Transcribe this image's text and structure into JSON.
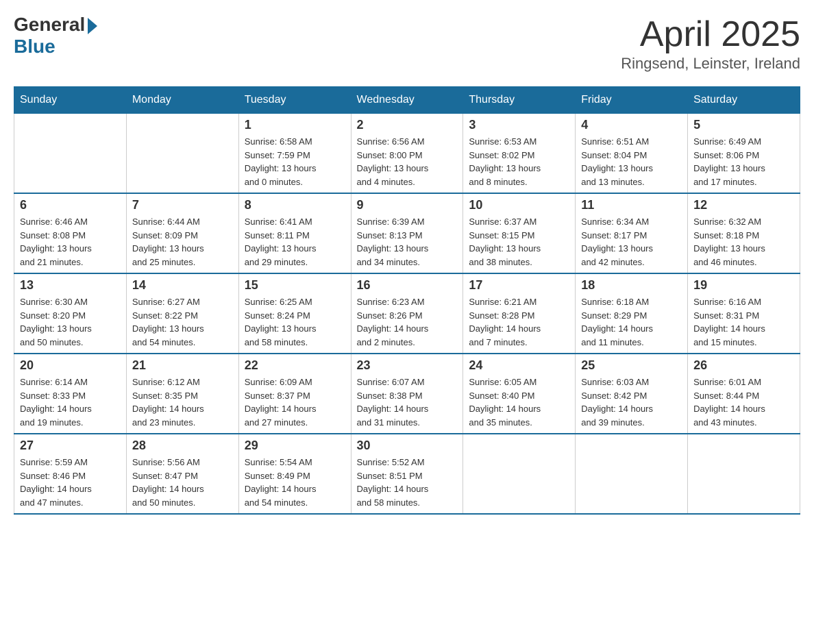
{
  "logo": {
    "general": "General",
    "blue": "Blue"
  },
  "title": "April 2025",
  "location": "Ringsend, Leinster, Ireland",
  "weekdays": [
    "Sunday",
    "Monday",
    "Tuesday",
    "Wednesday",
    "Thursday",
    "Friday",
    "Saturday"
  ],
  "weeks": [
    [
      {
        "day": "",
        "sunrise": "",
        "sunset": "",
        "daylight": ""
      },
      {
        "day": "",
        "sunrise": "",
        "sunset": "",
        "daylight": ""
      },
      {
        "day": "1",
        "sunrise": "Sunrise: 6:58 AM",
        "sunset": "Sunset: 7:59 PM",
        "daylight": "Daylight: 13 hours and 0 minutes."
      },
      {
        "day": "2",
        "sunrise": "Sunrise: 6:56 AM",
        "sunset": "Sunset: 8:00 PM",
        "daylight": "Daylight: 13 hours and 4 minutes."
      },
      {
        "day": "3",
        "sunrise": "Sunrise: 6:53 AM",
        "sunset": "Sunset: 8:02 PM",
        "daylight": "Daylight: 13 hours and 8 minutes."
      },
      {
        "day": "4",
        "sunrise": "Sunrise: 6:51 AM",
        "sunset": "Sunset: 8:04 PM",
        "daylight": "Daylight: 13 hours and 13 minutes."
      },
      {
        "day": "5",
        "sunrise": "Sunrise: 6:49 AM",
        "sunset": "Sunset: 8:06 PM",
        "daylight": "Daylight: 13 hours and 17 minutes."
      }
    ],
    [
      {
        "day": "6",
        "sunrise": "Sunrise: 6:46 AM",
        "sunset": "Sunset: 8:08 PM",
        "daylight": "Daylight: 13 hours and 21 minutes."
      },
      {
        "day": "7",
        "sunrise": "Sunrise: 6:44 AM",
        "sunset": "Sunset: 8:09 PM",
        "daylight": "Daylight: 13 hours and 25 minutes."
      },
      {
        "day": "8",
        "sunrise": "Sunrise: 6:41 AM",
        "sunset": "Sunset: 8:11 PM",
        "daylight": "Daylight: 13 hours and 29 minutes."
      },
      {
        "day": "9",
        "sunrise": "Sunrise: 6:39 AM",
        "sunset": "Sunset: 8:13 PM",
        "daylight": "Daylight: 13 hours and 34 minutes."
      },
      {
        "day": "10",
        "sunrise": "Sunrise: 6:37 AM",
        "sunset": "Sunset: 8:15 PM",
        "daylight": "Daylight: 13 hours and 38 minutes."
      },
      {
        "day": "11",
        "sunrise": "Sunrise: 6:34 AM",
        "sunset": "Sunset: 8:17 PM",
        "daylight": "Daylight: 13 hours and 42 minutes."
      },
      {
        "day": "12",
        "sunrise": "Sunrise: 6:32 AM",
        "sunset": "Sunset: 8:18 PM",
        "daylight": "Daylight: 13 hours and 46 minutes."
      }
    ],
    [
      {
        "day": "13",
        "sunrise": "Sunrise: 6:30 AM",
        "sunset": "Sunset: 8:20 PM",
        "daylight": "Daylight: 13 hours and 50 minutes."
      },
      {
        "day": "14",
        "sunrise": "Sunrise: 6:27 AM",
        "sunset": "Sunset: 8:22 PM",
        "daylight": "Daylight: 13 hours and 54 minutes."
      },
      {
        "day": "15",
        "sunrise": "Sunrise: 6:25 AM",
        "sunset": "Sunset: 8:24 PM",
        "daylight": "Daylight: 13 hours and 58 minutes."
      },
      {
        "day": "16",
        "sunrise": "Sunrise: 6:23 AM",
        "sunset": "Sunset: 8:26 PM",
        "daylight": "Daylight: 14 hours and 2 minutes."
      },
      {
        "day": "17",
        "sunrise": "Sunrise: 6:21 AM",
        "sunset": "Sunset: 8:28 PM",
        "daylight": "Daylight: 14 hours and 7 minutes."
      },
      {
        "day": "18",
        "sunrise": "Sunrise: 6:18 AM",
        "sunset": "Sunset: 8:29 PM",
        "daylight": "Daylight: 14 hours and 11 minutes."
      },
      {
        "day": "19",
        "sunrise": "Sunrise: 6:16 AM",
        "sunset": "Sunset: 8:31 PM",
        "daylight": "Daylight: 14 hours and 15 minutes."
      }
    ],
    [
      {
        "day": "20",
        "sunrise": "Sunrise: 6:14 AM",
        "sunset": "Sunset: 8:33 PM",
        "daylight": "Daylight: 14 hours and 19 minutes."
      },
      {
        "day": "21",
        "sunrise": "Sunrise: 6:12 AM",
        "sunset": "Sunset: 8:35 PM",
        "daylight": "Daylight: 14 hours and 23 minutes."
      },
      {
        "day": "22",
        "sunrise": "Sunrise: 6:09 AM",
        "sunset": "Sunset: 8:37 PM",
        "daylight": "Daylight: 14 hours and 27 minutes."
      },
      {
        "day": "23",
        "sunrise": "Sunrise: 6:07 AM",
        "sunset": "Sunset: 8:38 PM",
        "daylight": "Daylight: 14 hours and 31 minutes."
      },
      {
        "day": "24",
        "sunrise": "Sunrise: 6:05 AM",
        "sunset": "Sunset: 8:40 PM",
        "daylight": "Daylight: 14 hours and 35 minutes."
      },
      {
        "day": "25",
        "sunrise": "Sunrise: 6:03 AM",
        "sunset": "Sunset: 8:42 PM",
        "daylight": "Daylight: 14 hours and 39 minutes."
      },
      {
        "day": "26",
        "sunrise": "Sunrise: 6:01 AM",
        "sunset": "Sunset: 8:44 PM",
        "daylight": "Daylight: 14 hours and 43 minutes."
      }
    ],
    [
      {
        "day": "27",
        "sunrise": "Sunrise: 5:59 AM",
        "sunset": "Sunset: 8:46 PM",
        "daylight": "Daylight: 14 hours and 47 minutes."
      },
      {
        "day": "28",
        "sunrise": "Sunrise: 5:56 AM",
        "sunset": "Sunset: 8:47 PM",
        "daylight": "Daylight: 14 hours and 50 minutes."
      },
      {
        "day": "29",
        "sunrise": "Sunrise: 5:54 AM",
        "sunset": "Sunset: 8:49 PM",
        "daylight": "Daylight: 14 hours and 54 minutes."
      },
      {
        "day": "30",
        "sunrise": "Sunrise: 5:52 AM",
        "sunset": "Sunset: 8:51 PM",
        "daylight": "Daylight: 14 hours and 58 minutes."
      },
      {
        "day": "",
        "sunrise": "",
        "sunset": "",
        "daylight": ""
      },
      {
        "day": "",
        "sunrise": "",
        "sunset": "",
        "daylight": ""
      },
      {
        "day": "",
        "sunrise": "",
        "sunset": "",
        "daylight": ""
      }
    ]
  ]
}
